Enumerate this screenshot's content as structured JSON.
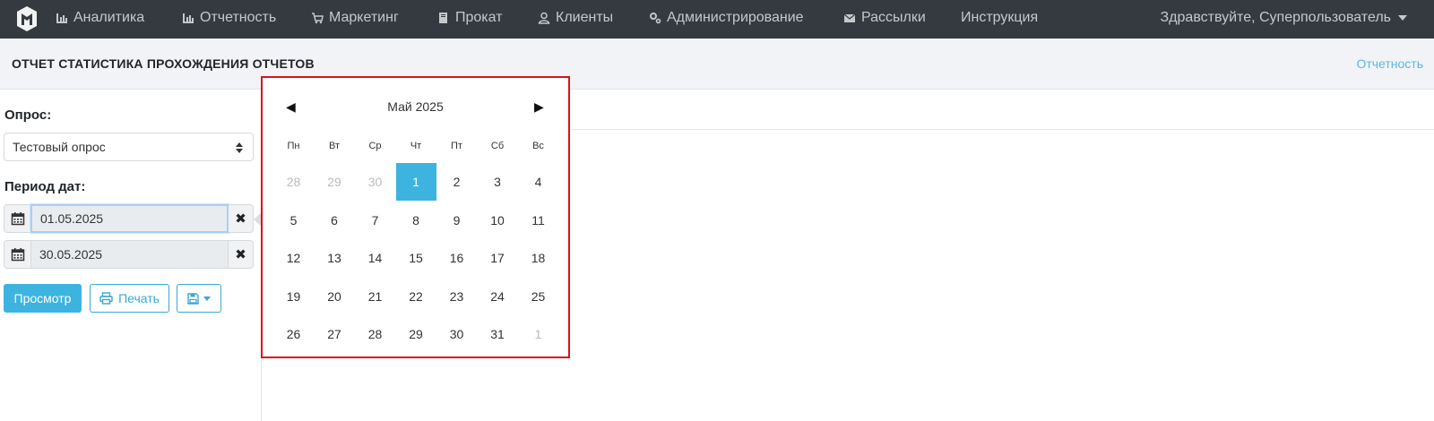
{
  "nav": {
    "items": [
      {
        "label": "Аналитика",
        "icon": "bar-chart-icon"
      },
      {
        "label": "Отчетность",
        "icon": "bar-chart-icon"
      },
      {
        "label": "Маркетинг",
        "icon": "cart-icon"
      },
      {
        "label": "Прокат",
        "icon": "book-icon"
      },
      {
        "label": "Клиенты",
        "icon": "user-icon"
      },
      {
        "label": "Администрирование",
        "icon": "gears-icon"
      },
      {
        "label": "Рассылки",
        "icon": "envelope-icon"
      },
      {
        "label": "Инструкция",
        "icon": ""
      }
    ],
    "greeting": "Здравствуйте, Суперпользователь"
  },
  "header": {
    "title": "ОТЧЕТ СТАТИСТИКА ПРОХОЖДЕНИЯ ОТЧЕТОВ",
    "breadcrumb": "Отчетность"
  },
  "form": {
    "survey_label": "Опрос:",
    "survey_value": "Тестовый опрос",
    "period_label": "Период дат:",
    "date_from": "01.05.2025",
    "date_to": "30.05.2025",
    "view_button": "Просмотр",
    "print_button": "Печать"
  },
  "calendar": {
    "month_title": "Май 2025",
    "prev": "◀",
    "next": "▶",
    "weekdays": [
      "Пн",
      "Вт",
      "Ср",
      "Чт",
      "Пт",
      "Сб",
      "Вс"
    ],
    "weeks": [
      [
        "28",
        "29",
        "30",
        "1",
        "2",
        "3",
        "4"
      ],
      [
        "5",
        "6",
        "7",
        "8",
        "9",
        "10",
        "11"
      ],
      [
        "12",
        "13",
        "14",
        "15",
        "16",
        "17",
        "18"
      ],
      [
        "19",
        "20",
        "21",
        "22",
        "23",
        "24",
        "25"
      ],
      [
        "26",
        "27",
        "28",
        "29",
        "30",
        "31",
        "1"
      ]
    ],
    "selected_day": "1"
  },
  "colors": {
    "nav_bg": "#343a40",
    "accent": "#3db3e0",
    "highlight_border": "#d9121b"
  }
}
